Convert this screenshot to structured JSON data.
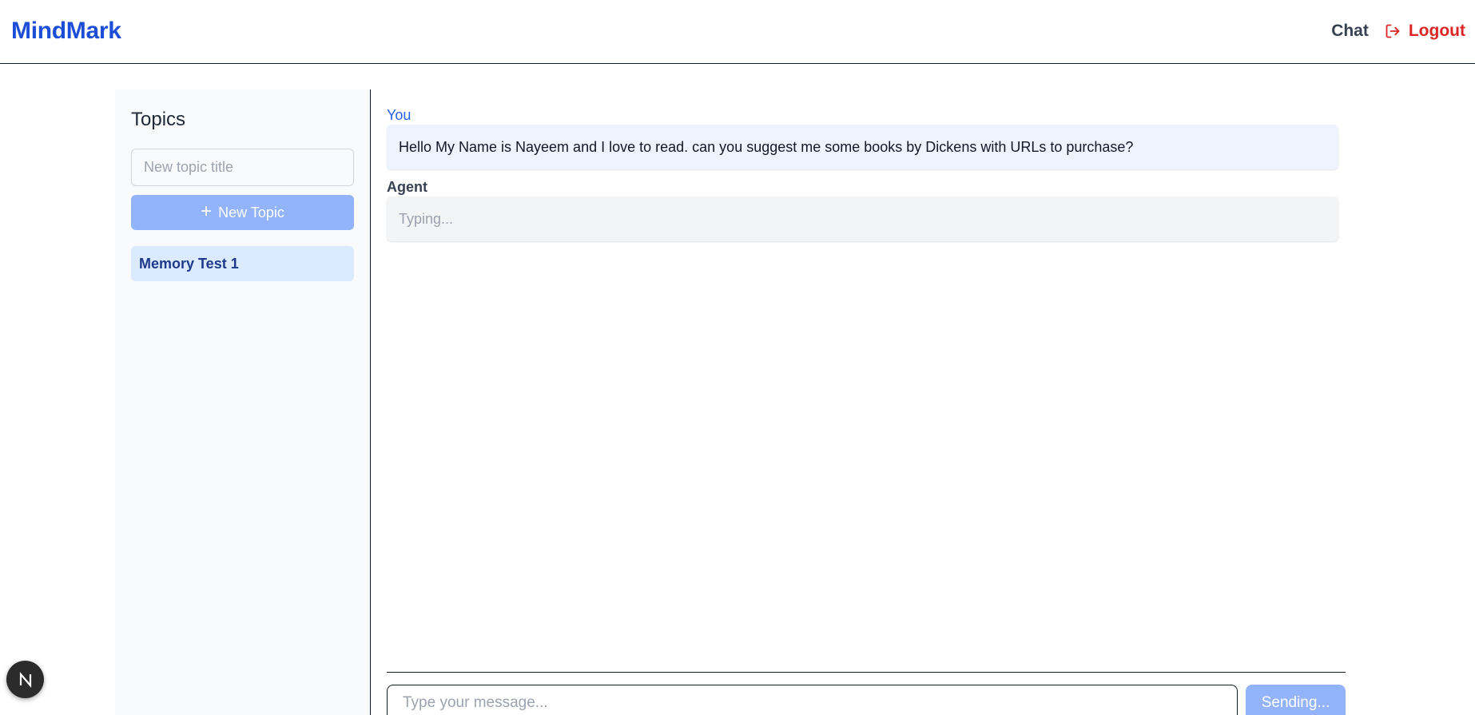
{
  "app": {
    "brand": "MindMark",
    "nav": {
      "chat_label": "Chat",
      "logout_label": "Logout",
      "logout_icon": "logout-icon"
    }
  },
  "sidebar": {
    "title": "Topics",
    "new_topic_input": {
      "placeholder": "New topic title",
      "value": ""
    },
    "new_topic_button": {
      "label": "New Topic",
      "icon": "plus-icon"
    },
    "topics": [
      {
        "label": "Memory Test 1",
        "active": true
      }
    ]
  },
  "chat": {
    "messages": [
      {
        "role": "You",
        "text": "Hello My Name is Nayeem and I love to read. can you suggest me some books by Dickens with URLs to purchase?"
      },
      {
        "role": "Agent",
        "text": "Typing..."
      }
    ],
    "composer": {
      "placeholder": "Type your message...",
      "value": "",
      "send_label": "Sending..."
    }
  },
  "dev_badge": {
    "label": "N"
  },
  "colors": {
    "brand": "#1d4ed8",
    "logout": "#dc2626",
    "button_disabled": "#93b4fb",
    "active_topic_bg": "#dbeafe",
    "user_bubble_bg": "#eef4fe",
    "agent_bubble_bg": "#f3f4f6"
  }
}
